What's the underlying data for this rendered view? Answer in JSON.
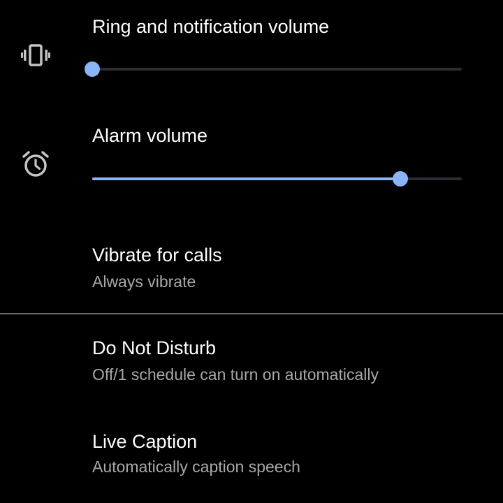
{
  "colors": {
    "background": "#000000",
    "accent": "#8ab4f8",
    "track": "#2a2e35",
    "title_text": "#ffffff",
    "summary_text": "#a8a8a8",
    "icon": "#c4c4c4",
    "divider": "#6e6e6e"
  },
  "ring_volume": {
    "icon": "vibrate-icon",
    "title": "Ring and notification volume",
    "level": 0.0
  },
  "alarm_volume": {
    "icon": "alarm-clock-icon",
    "title": "Alarm volume",
    "level": 0.833
  },
  "vibrate_for_calls": {
    "title": "Vibrate for calls",
    "summary": "Always vibrate"
  },
  "do_not_disturb": {
    "title": "Do Not Disturb",
    "summary": "Off/1 schedule can turn on automatically"
  },
  "live_caption": {
    "title": "Live Caption",
    "summary": "Automatically caption speech"
  }
}
